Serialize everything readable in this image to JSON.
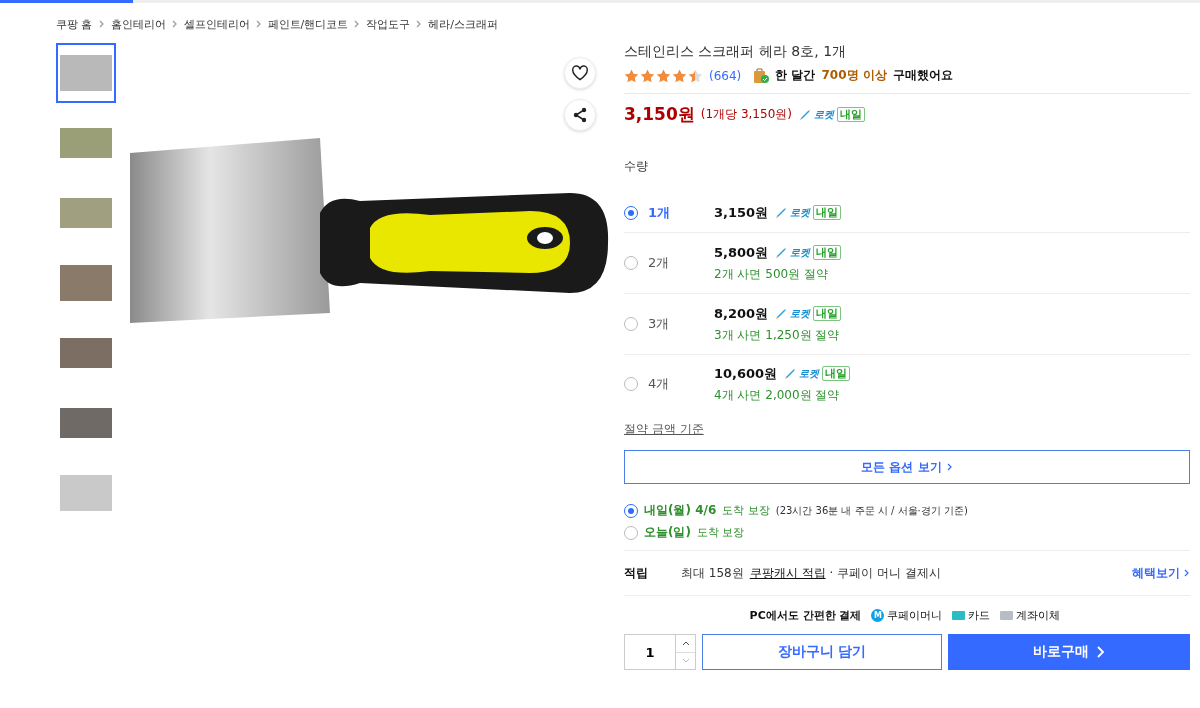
{
  "breadcrumb": [
    "쿠팡 홈",
    "홈인테리어",
    "셀프인테리어",
    "페인트/핸디코트",
    "작업도구",
    "헤라/스크래퍼"
  ],
  "thumbnails": [
    {
      "selected": true
    },
    {
      "selected": false
    },
    {
      "selected": false
    },
    {
      "selected": false
    },
    {
      "selected": false
    },
    {
      "selected": false
    },
    {
      "selected": false
    }
  ],
  "product": {
    "title": "스테인리스 스크래퍼 헤라 8호, 1개",
    "rating": {
      "stars": 4.5,
      "count": "(664)"
    },
    "purchase_note": {
      "prefix": "한 달간",
      "highlight": "700명 이상",
      "suffix": "구매했어요"
    },
    "price": "3,150원",
    "unit_price": "(1개당 3,150원)",
    "rocket": "로켓",
    "rocket_day": "내일"
  },
  "quantity_label": "수량",
  "options": [
    {
      "label": "1개",
      "price": "3,150원",
      "rocket": "로켓",
      "rocket_day": "내일",
      "selected": true
    },
    {
      "label": "2개",
      "price": "5,800원",
      "rocket": "로켓",
      "rocket_day": "내일",
      "savings": "2개 사면 500원 절약",
      "selected": false
    },
    {
      "label": "3개",
      "price": "8,200원",
      "rocket": "로켓",
      "rocket_day": "내일",
      "savings": "3개 사면 1,250원 절약",
      "selected": false
    },
    {
      "label": "4개",
      "price": "10,600원",
      "rocket": "로켓",
      "rocket_day": "내일",
      "savings": "4개 사면 2,000원 절약",
      "selected": false
    }
  ],
  "savings_link": "절약 금액 기준",
  "all_options_button": "모든 옵션 보기",
  "delivery_options": [
    {
      "label": "내일(월) 4/6",
      "suffix": "도착 보장",
      "note": "(23시간 36분 내 주문 시 / 서울·경기 기준)",
      "selected": true
    },
    {
      "label": "오늘(일)",
      "suffix": "도착 보장",
      "selected": false
    }
  ],
  "reward": {
    "label": "적립",
    "text": "최대 158원",
    "link": "쿠팡캐시 적립",
    "suffix": "· 쿠페이 머니 결제시",
    "benefit_link": "혜택보기"
  },
  "payment": {
    "title": "PC에서도 간편한 결제",
    "methods": [
      {
        "kind": "coupay",
        "icon_letter": "M",
        "label": "쿠페이머니"
      },
      {
        "kind": "card",
        "label": "카드"
      },
      {
        "kind": "bank",
        "label": "계좌이체"
      }
    ]
  },
  "quantity_input": "1",
  "cart_button": "장바구니 담기",
  "buy_button": "바로구매"
}
